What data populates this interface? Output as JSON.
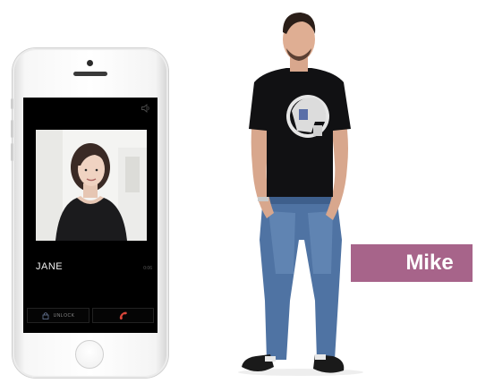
{
  "phone_screen": {
    "caller_name": "JANE",
    "call_timer": "0:06",
    "unlock_label": "UNLOCK",
    "icons": {
      "speaker": "speaker-icon",
      "unlock": "lock-icon",
      "hangup": "hangup-phone-icon"
    },
    "colors": {
      "hangup": "#d9463a"
    }
  },
  "person_label": {
    "name": "Mike",
    "background": "#a7648a"
  }
}
